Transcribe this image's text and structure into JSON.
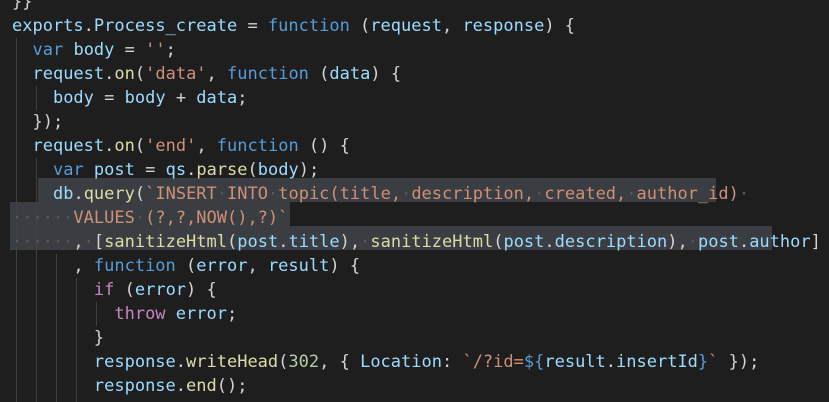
{
  "editor": {
    "lines": [
      [
        [
          "p",
          "}}"
        ]
      ],
      [
        [
          "v",
          "exports"
        ],
        [
          "p",
          "."
        ],
        [
          "v",
          "Process_create"
        ],
        [
          "p",
          " = "
        ],
        [
          "k",
          "function"
        ],
        [
          "p",
          " ("
        ],
        [
          "v",
          "request"
        ],
        [
          "p",
          ", "
        ],
        [
          "v",
          "response"
        ],
        [
          "p",
          ") {"
        ]
      ],
      [
        [
          "p",
          "  "
        ],
        [
          "k",
          "var"
        ],
        [
          "p",
          " "
        ],
        [
          "v",
          "body"
        ],
        [
          "p",
          " = "
        ],
        [
          "s",
          "''"
        ],
        [
          "p",
          ";"
        ]
      ],
      [
        [
          "p",
          "  "
        ],
        [
          "v",
          "request"
        ],
        [
          "p",
          "."
        ],
        [
          "f",
          "on"
        ],
        [
          "p",
          "("
        ],
        [
          "s",
          "'data'"
        ],
        [
          "p",
          ", "
        ],
        [
          "k",
          "function"
        ],
        [
          "p",
          " ("
        ],
        [
          "v",
          "data"
        ],
        [
          "p",
          ") {"
        ]
      ],
      [
        [
          "p",
          "    "
        ],
        [
          "v",
          "body"
        ],
        [
          "p",
          " = "
        ],
        [
          "v",
          "body"
        ],
        [
          "p",
          " + "
        ],
        [
          "v",
          "data"
        ],
        [
          "p",
          ";"
        ]
      ],
      [
        [
          "p",
          "  });"
        ]
      ],
      [
        [
          "p",
          "  "
        ],
        [
          "v",
          "request"
        ],
        [
          "p",
          "."
        ],
        [
          "f",
          "on"
        ],
        [
          "p",
          "("
        ],
        [
          "s",
          "'end'"
        ],
        [
          "p",
          ", "
        ],
        [
          "k",
          "function"
        ],
        [
          "p",
          " () {"
        ]
      ],
      [
        [
          "p",
          "    "
        ],
        [
          "k",
          "var"
        ],
        [
          "p",
          " "
        ],
        [
          "v",
          "post"
        ],
        [
          "p",
          " = "
        ],
        [
          "v",
          "qs"
        ],
        [
          "p",
          "."
        ],
        [
          "f",
          "parse"
        ],
        [
          "p",
          "("
        ],
        [
          "v",
          "body"
        ],
        [
          "p",
          ");"
        ]
      ],
      [
        [
          "p",
          "    "
        ],
        [
          "v",
          "db"
        ],
        [
          "p",
          "."
        ],
        [
          "f",
          "query"
        ],
        [
          "p",
          "("
        ],
        [
          "s",
          "`INSERT"
        ],
        [
          "sp",
          "·"
        ],
        [
          "s",
          "INTO"
        ],
        [
          "sp",
          "·"
        ],
        [
          "s",
          "topic(title,"
        ],
        [
          "sp",
          "·"
        ],
        [
          "s",
          "description,"
        ],
        [
          "sp",
          "·"
        ],
        [
          "s",
          "created,"
        ],
        [
          "sp",
          "·"
        ],
        [
          "s",
          "author_id)"
        ],
        [
          "sp",
          "·"
        ]
      ],
      [
        [
          "sp",
          "······"
        ],
        [
          "s",
          "VALUES"
        ],
        [
          "sp",
          "·"
        ],
        [
          "s",
          "(?,?,NOW(),?)`"
        ]
      ],
      [
        [
          "sp",
          "······"
        ],
        [
          "p",
          ","
        ],
        [
          "sp",
          "·"
        ],
        [
          "p",
          "["
        ],
        [
          "f",
          "sanitizeHtml"
        ],
        [
          "p",
          "("
        ],
        [
          "v",
          "post"
        ],
        [
          "p",
          "."
        ],
        [
          "v",
          "title"
        ],
        [
          "p",
          "),"
        ],
        [
          "sp",
          "·"
        ],
        [
          "f",
          "sanitizeHtml"
        ],
        [
          "p",
          "("
        ],
        [
          "v",
          "post"
        ],
        [
          "p",
          "."
        ],
        [
          "v",
          "description"
        ],
        [
          "p",
          "),"
        ],
        [
          "sp",
          "·"
        ],
        [
          "v",
          "post"
        ],
        [
          "p",
          "."
        ],
        [
          "v",
          "author"
        ],
        [
          "p",
          "]"
        ]
      ],
      [
        [
          "p",
          "      , "
        ],
        [
          "k",
          "function"
        ],
        [
          "p",
          " ("
        ],
        [
          "v",
          "error"
        ],
        [
          "p",
          ", "
        ],
        [
          "v",
          "result"
        ],
        [
          "p",
          ") {"
        ]
      ],
      [
        [
          "p",
          "        "
        ],
        [
          "c",
          "if"
        ],
        [
          "p",
          " ("
        ],
        [
          "v",
          "error"
        ],
        [
          "p",
          ") {"
        ]
      ],
      [
        [
          "p",
          "          "
        ],
        [
          "c",
          "throw"
        ],
        [
          "p",
          " "
        ],
        [
          "v",
          "error"
        ],
        [
          "p",
          ";"
        ]
      ],
      [
        [
          "p",
          "        }"
        ]
      ],
      [
        [
          "p",
          "        "
        ],
        [
          "v",
          "response"
        ],
        [
          "p",
          "."
        ],
        [
          "f",
          "writeHead"
        ],
        [
          "p",
          "("
        ],
        [
          "n",
          "302"
        ],
        [
          "p",
          ", { "
        ],
        [
          "v",
          "Location"
        ],
        [
          "p",
          ": "
        ],
        [
          "s",
          "`/?id="
        ],
        [
          "k",
          "${"
        ],
        [
          "v",
          "result"
        ],
        [
          "p",
          "."
        ],
        [
          "v",
          "insertId"
        ],
        [
          "k",
          "}"
        ],
        [
          "s",
          "`"
        ],
        [
          "p",
          " });"
        ]
      ],
      [
        [
          "p",
          "        "
        ],
        [
          "v",
          "response"
        ],
        [
          "p",
          "."
        ],
        [
          "f",
          "end"
        ],
        [
          "p",
          "();"
        ]
      ],
      [
        [
          "p",
          "      })"
        ]
      ]
    ]
  }
}
